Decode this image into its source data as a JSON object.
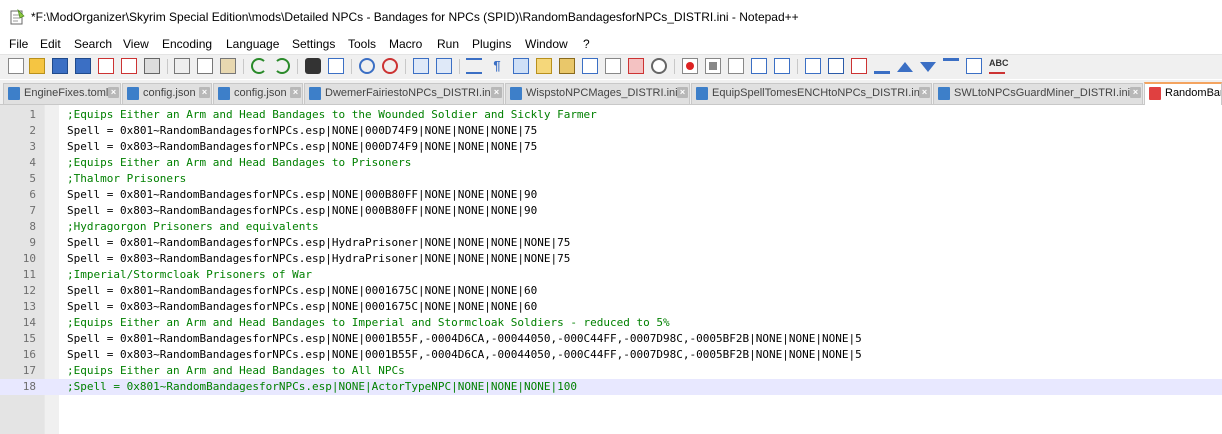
{
  "window": {
    "title": "*F:\\ModOrganizer\\Skyrim Special Edition\\mods\\Detailed NPCs - Bandages for NPCs (SPID)\\RandomBandagesforNPCs_DISTRI.ini - Notepad++"
  },
  "menu": [
    "File",
    "Edit",
    "Search",
    "View",
    "Encoding",
    "Language",
    "Settings",
    "Tools",
    "Macro",
    "Run",
    "Plugins",
    "Window",
    "?"
  ],
  "tabs": [
    {
      "label": "EngineFixes.toml",
      "active": false
    },
    {
      "label": "config.json",
      "active": false
    },
    {
      "label": "config.json",
      "active": false
    },
    {
      "label": "DwemerFairiestoNPCs_DISTRI.ini",
      "active": false
    },
    {
      "label": "WispstoNPCMages_DISTRI.ini",
      "active": false
    },
    {
      "label": "EquipSpellTomesENCHtoNPCs_DISTRI.ini",
      "active": false
    },
    {
      "label": "SWLtoNPCsGuardMiner_DISTRI.ini",
      "active": false
    },
    {
      "label": "RandomBan",
      "active": true
    }
  ],
  "toolbar_icons": [
    "new-file-icon",
    "open-file-icon",
    "save-icon",
    "save-all-icon",
    "close-icon",
    "close-all-icon",
    "print-icon",
    "cut-icon",
    "copy-icon",
    "paste-icon",
    "undo-icon",
    "redo-icon",
    "find-icon",
    "replace-icon",
    "zoom-in-icon",
    "zoom-out-icon",
    "sync-vertical-icon",
    "sync-horizontal-icon",
    "word-wrap-icon",
    "show-all-chars-icon",
    "indent-guide-icon",
    "language-define-icon",
    "document-map-icon",
    "function-list-icon",
    "folder-workspace-icon",
    "monitoring-icon",
    "record-macro-icon",
    "stop-macro-icon",
    "play-macro-icon",
    "run-macro-multiple-icon",
    "save-macro-icon",
    "insert-comment-icon",
    "compare-icon",
    "clear-compare-icon",
    "first-diff-icon",
    "prev-diff-icon",
    "next-diff-icon",
    "last-diff-icon",
    "diff-navigation-icon",
    "spell-check-icon"
  ],
  "editor": {
    "current_line": 18,
    "lines": [
      {
        "n": "1",
        "text": ";Equips Either an Arm and Head Bandages to the Wounded Soldier and Sickly Farmer",
        "comment": true
      },
      {
        "n": "2",
        "text": "Spell = 0x801~RandomBandagesforNPCs.esp|NONE|000D74F9|NONE|NONE|NONE|75",
        "comment": false
      },
      {
        "n": "3",
        "text": "Spell = 0x803~RandomBandagesforNPCs.esp|NONE|000D74F9|NONE|NONE|NONE|75",
        "comment": false
      },
      {
        "n": "4",
        "text": ";Equips Either an Arm and Head Bandages to Prisoners",
        "comment": true
      },
      {
        "n": "5",
        "text": ";Thalmor Prisoners",
        "comment": true
      },
      {
        "n": "6",
        "text": "Spell = 0x801~RandomBandagesforNPCs.esp|NONE|000B80FF|NONE|NONE|NONE|90",
        "comment": false
      },
      {
        "n": "7",
        "text": "Spell = 0x803~RandomBandagesforNPCs.esp|NONE|000B80FF|NONE|NONE|NONE|90",
        "comment": false
      },
      {
        "n": "8",
        "text": ";Hydragorgon Prisoners and equivalents",
        "comment": true
      },
      {
        "n": "9",
        "text": "Spell = 0x801~RandomBandagesforNPCs.esp|HydraPrisoner|NONE|NONE|NONE|NONE|75",
        "comment": false
      },
      {
        "n": "10",
        "text": "Spell = 0x803~RandomBandagesforNPCs.esp|HydraPrisoner|NONE|NONE|NONE|NONE|75",
        "comment": false
      },
      {
        "n": "11",
        "text": ";Imperial/Stormcloak Prisoners of War",
        "comment": true
      },
      {
        "n": "12",
        "text": "Spell = 0x801~RandomBandagesforNPCs.esp|NONE|0001675C|NONE|NONE|NONE|60",
        "comment": false
      },
      {
        "n": "13",
        "text": "Spell = 0x803~RandomBandagesforNPCs.esp|NONE|0001675C|NONE|NONE|NONE|60",
        "comment": false
      },
      {
        "n": "14",
        "text": ";Equips Either an Arm and Head Bandages to Imperial and Stormcloak Soldiers - reduced to 5%",
        "comment": true
      },
      {
        "n": "15",
        "text": "Spell = 0x801~RandomBandagesforNPCs.esp|NONE|0001B55F,-0004D6CA,-00044050,-000C44FF,-0007D98C,-0005BF2B|NONE|NONE|NONE|5",
        "comment": false
      },
      {
        "n": "16",
        "text": "Spell = 0x803~RandomBandagesforNPCs.esp|NONE|0001B55F,-0004D6CA,-00044050,-000C44FF,-0007D98C,-0005BF2B|NONE|NONE|NONE|5",
        "comment": false
      },
      {
        "n": "17",
        "text": ";Equips Either an Arm and Head Bandages to All NPCs",
        "comment": true
      },
      {
        "n": "18",
        "text": ";Spell = 0x801~RandomBandagesforNPCs.esp|NONE|ActorTypeNPC|NONE|NONE|NONE|100",
        "comment": true
      }
    ]
  },
  "colors": {
    "comment": "#008000",
    "current_line": "#e8e8ff",
    "gutter": "#e4e4e4",
    "active_tab_accent": "#f4a460"
  }
}
